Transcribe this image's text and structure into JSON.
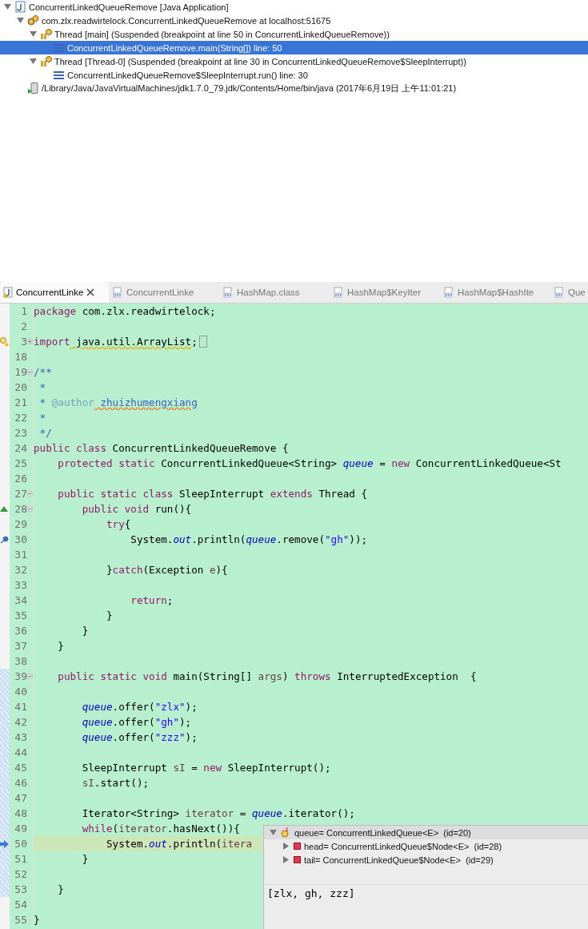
{
  "debug_tree": [
    {
      "kind": "launch",
      "label": "ConcurrentLinkedQueueRemove [Java Application]",
      "expanded": true,
      "selected": false,
      "children": [
        {
          "kind": "target",
          "label": "com.zlx.readwirtelock.ConcurrentLinkedQueueRemove at localhost:51675",
          "expanded": true,
          "selected": false,
          "children": [
            {
              "kind": "thread",
              "label": "Thread [main] (Suspended (breakpoint at line 50 in ConcurrentLinkedQueueRemove))",
              "expanded": true,
              "selected": false,
              "children": [
                {
                  "kind": "frame",
                  "label": "ConcurrentLinkedQueueRemove.main(String[]) line: 50",
                  "selected": true
                }
              ]
            },
            {
              "kind": "thread",
              "label": "Thread [Thread-0] (Suspended (breakpoint at line 30 in ConcurrentLinkedQueueRemove$SleepInterrupt))",
              "expanded": true,
              "selected": false,
              "children": [
                {
                  "kind": "frame",
                  "label": "ConcurrentLinkedQueueRemove$SleepInterrupt.run() line: 30",
                  "selected": false
                }
              ]
            }
          ]
        },
        {
          "kind": "process",
          "label": "/Library/Java/JavaVirtualMachines/jdk1.7.0_79.jdk/Contents/Home/bin/java (2017年6月19日 上午11:01:21)",
          "selected": false
        }
      ]
    }
  ],
  "editor_tabs": [
    {
      "kind": "source",
      "label": "ConcurrentLinke",
      "selected": true
    },
    {
      "kind": "class",
      "label": "ConcurrentLinke",
      "selected": false
    },
    {
      "kind": "class",
      "label": "HashMap.class",
      "selected": false
    },
    {
      "kind": "class",
      "label": "HashMap$KeyIter",
      "selected": false
    },
    {
      "kind": "class",
      "label": "HashMap$HashIte",
      "selected": false
    },
    {
      "kind": "class",
      "label": "Que",
      "selected": false
    }
  ],
  "code_lines": [
    {
      "number": "1",
      "tokens": [
        {
          "kind": "kw",
          "text": "package"
        },
        {
          "kind": "plain",
          "text": " com.zlx.readwirtelock;"
        }
      ]
    },
    {
      "number": "2"
    },
    {
      "number": "3",
      "fold": {
        "expanded": false
      },
      "marker": {
        "kind": "warning"
      },
      "folded": true,
      "tokens": [
        {
          "kind": "kw",
          "text": "import"
        },
        {
          "kind": "warn",
          "text": " java.util.ArrayList"
        },
        {
          "kind": "plain",
          "text": ";"
        }
      ]
    },
    {
      "number": "18"
    },
    {
      "number": "19",
      "fold": {
        "expanded": true
      },
      "tokens": [
        {
          "kind": "comment",
          "text": "/**"
        }
      ]
    },
    {
      "number": "20",
      "tokens": [
        {
          "kind": "comment",
          "text": " *"
        }
      ]
    },
    {
      "number": "21",
      "tokens": [
        {
          "kind": "comment",
          "text": " * "
        },
        {
          "kind": "tag",
          "text": "@author"
        },
        {
          "kind": "spell",
          "text": " zhuizhumengxiang"
        }
      ]
    },
    {
      "number": "22",
      "tokens": [
        {
          "kind": "comment",
          "text": " *"
        }
      ]
    },
    {
      "number": "23",
      "tokens": [
        {
          "kind": "comment",
          "text": " */"
        }
      ]
    },
    {
      "number": "24",
      "tokens": [
        {
          "kind": "kw",
          "text": "public class"
        },
        {
          "kind": "plain",
          "text": " ConcurrentLinkedQueueRemove {"
        }
      ]
    },
    {
      "number": "25",
      "tokens": [
        {
          "kind": "kw",
          "text": "    protected static"
        },
        {
          "kind": "plain",
          "text": " ConcurrentLinkedQueue<String> "
        },
        {
          "kind": "field",
          "text": "queue"
        },
        {
          "kind": "plain",
          "text": " = "
        },
        {
          "kind": "kw",
          "text": "new"
        },
        {
          "kind": "plain",
          "text": " ConcurrentLinkedQueue<St"
        }
      ]
    },
    {
      "number": "26"
    },
    {
      "number": "27",
      "fold": {
        "expanded": true
      },
      "tokens": [
        {
          "kind": "kw",
          "text": "    public static class"
        },
        {
          "kind": "plain",
          "text": " SleepInterrupt "
        },
        {
          "kind": "kw",
          "text": "extends"
        },
        {
          "kind": "plain",
          "text": " Thread {"
        }
      ]
    },
    {
      "number": "28",
      "fold": {
        "expanded": true
      },
      "marker": {
        "kind": "override"
      },
      "tokens": [
        {
          "kind": "kw",
          "text": "        public void"
        },
        {
          "kind": "plain",
          "text": " run(){"
        }
      ]
    },
    {
      "number": "29",
      "tokens": [
        {
          "kind": "kw",
          "text": "            try"
        },
        {
          "kind": "plain",
          "text": "{"
        }
      ]
    },
    {
      "number": "30",
      "marker": {
        "kind": "breakpoint"
      },
      "tokens": [
        {
          "kind": "plain",
          "text": "                System."
        },
        {
          "kind": "field",
          "text": "out"
        },
        {
          "kind": "plain",
          "text": ".println("
        },
        {
          "kind": "field",
          "text": "queue"
        },
        {
          "kind": "plain",
          "text": ".remove("
        },
        {
          "kind": "str",
          "text": "\"gh\""
        },
        {
          "kind": "plain",
          "text": "));"
        }
      ]
    },
    {
      "number": "31"
    },
    {
      "number": "32",
      "tokens": [
        {
          "kind": "plain",
          "text": "            }"
        },
        {
          "kind": "kw",
          "text": "catch"
        },
        {
          "kind": "plain",
          "text": "(Exception "
        },
        {
          "kind": "local",
          "text": "e"
        },
        {
          "kind": "plain",
          "text": "){"
        }
      ]
    },
    {
      "number": "33"
    },
    {
      "number": "34",
      "tokens": [
        {
          "kind": "kw",
          "text": "                return"
        },
        {
          "kind": "plain",
          "text": ";"
        }
      ]
    },
    {
      "number": "35",
      "tokens": [
        {
          "kind": "plain",
          "text": "            }"
        }
      ]
    },
    {
      "number": "36",
      "tokens": [
        {
          "kind": "plain",
          "text": "        }"
        }
      ]
    },
    {
      "number": "37",
      "tokens": [
        {
          "kind": "plain",
          "text": "    }"
        }
      ]
    },
    {
      "number": "38"
    },
    {
      "number": "39",
      "fold": {
        "expanded": true
      },
      "range": true,
      "tokens": [
        {
          "kind": "kw",
          "text": "    public static void"
        },
        {
          "kind": "plain",
          "text": " main(String[] "
        },
        {
          "kind": "local",
          "text": "args"
        },
        {
          "kind": "plain",
          "text": ") "
        },
        {
          "kind": "kw",
          "text": "throws"
        },
        {
          "kind": "plain",
          "text": " InterruptedException  {"
        }
      ]
    },
    {
      "number": "40",
      "range": true
    },
    {
      "number": "41",
      "range": true,
      "tokens": [
        {
          "kind": "field",
          "text": "        queue"
        },
        {
          "kind": "plain",
          "text": ".offer("
        },
        {
          "kind": "str",
          "text": "\"zlx\""
        },
        {
          "kind": "plain",
          "text": ");"
        }
      ]
    },
    {
      "number": "42",
      "range": true,
      "tokens": [
        {
          "kind": "field",
          "text": "        queue"
        },
        {
          "kind": "plain",
          "text": ".offer("
        },
        {
          "kind": "str",
          "text": "\"gh\""
        },
        {
          "kind": "plain",
          "text": ");"
        }
      ]
    },
    {
      "number": "43",
      "range": true,
      "tokens": [
        {
          "kind": "field",
          "text": "        queue"
        },
        {
          "kind": "plain",
          "text": ".offer("
        },
        {
          "kind": "str",
          "text": "\"zzz\""
        },
        {
          "kind": "plain",
          "text": ");"
        }
      ]
    },
    {
      "number": "44",
      "range": true
    },
    {
      "number": "45",
      "range": true,
      "tokens": [
        {
          "kind": "plain",
          "text": "        SleepInterrupt "
        },
        {
          "kind": "local",
          "text": "sI"
        },
        {
          "kind": "plain",
          "text": " = "
        },
        {
          "kind": "kw",
          "text": "new"
        },
        {
          "kind": "plain",
          "text": " SleepInterrupt();"
        }
      ]
    },
    {
      "number": "46",
      "range": true,
      "tokens": [
        {
          "kind": "local",
          "text": "        sI"
        },
        {
          "kind": "plain",
          "text": ".start();"
        }
      ]
    },
    {
      "number": "47",
      "range": true
    },
    {
      "number": "48",
      "range": true,
      "tokens": [
        {
          "kind": "plain",
          "text": "        Iterator<String> "
        },
        {
          "kind": "local",
          "text": "iterator"
        },
        {
          "kind": "plain",
          "text": " = "
        },
        {
          "kind": "field",
          "text": "queue"
        },
        {
          "kind": "plain",
          "text": ".iterator();"
        }
      ]
    },
    {
      "number": "49",
      "range": true,
      "tokens": [
        {
          "kind": "kw",
          "text": "        while"
        },
        {
          "kind": "plain",
          "text": "("
        },
        {
          "kind": "local",
          "text": "iterator"
        },
        {
          "kind": "plain",
          "text": ".hasNext()){"
        }
      ]
    },
    {
      "number": "50",
      "range": true,
      "current": true,
      "marker": {
        "kind": "pointer"
      },
      "tokens": [
        {
          "kind": "plain",
          "text": "            System."
        },
        {
          "kind": "field",
          "text": "out"
        },
        {
          "kind": "plain",
          "text": ".println("
        },
        {
          "kind": "local",
          "text": "itera"
        }
      ]
    },
    {
      "number": "51",
      "range": true,
      "tokens": [
        {
          "kind": "plain",
          "text": "        }"
        }
      ]
    },
    {
      "number": "52",
      "range": true
    },
    {
      "number": "53",
      "range": true,
      "tokens": [
        {
          "kind": "plain",
          "text": "    }"
        }
      ]
    },
    {
      "number": "54"
    },
    {
      "number": "55",
      "tokens": [
        {
          "kind": "plain",
          "text": "}"
        }
      ]
    }
  ],
  "inspect_popup": {
    "variables": [
      {
        "kind": "static",
        "name": "queue=",
        "value": "ConcurrentLinkedQueue<E>  (id=20)",
        "expanded": true,
        "selected": true,
        "children": [
          {
            "kind": "private",
            "name": "head=",
            "value": "ConcurrentLinkedQueue$Node<E>  (id=28)",
            "expanded": false,
            "selected": false
          },
          {
            "kind": "private",
            "name": "tail=",
            "value": "ConcurrentLinkedQueue$Node<E>  (id=29)",
            "expanded": false,
            "selected": false
          }
        ]
      }
    ],
    "detail": "[zlx, gh, zzz]"
  }
}
